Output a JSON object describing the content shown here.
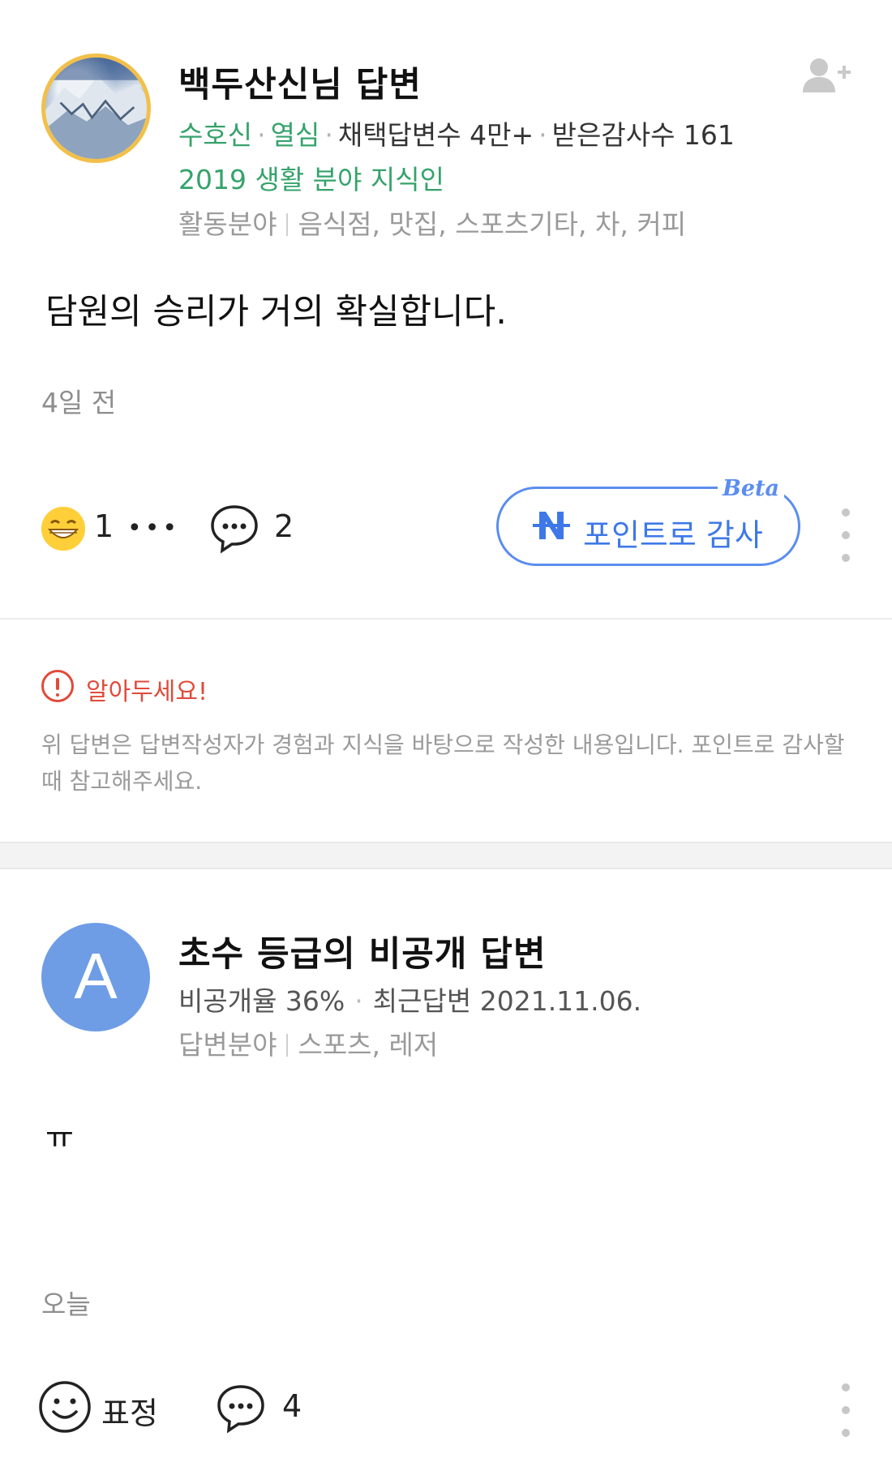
{
  "answer1": {
    "author": "백두산신님 답변",
    "grade": "수호신",
    "activity": "열심",
    "adopted": "채택답변수 4만+",
    "thanks": "받은감사수 161",
    "expert": "2019 생활 분야 지식인",
    "field_label": "활동분야",
    "fields": "음식점, 맛집, 스포츠기타, 차, 커피",
    "body": "담원의 승리가 거의 확실합니다.",
    "time": "4일 전",
    "reaction_count": "1",
    "more": "•••",
    "comment_count": "2",
    "point_button": "포인트로 감사",
    "beta": "Beta"
  },
  "notice": {
    "title": "알아두세요!",
    "text": "위 답변은 답변작성자가 경험과 지식을 바탕으로 작성한 내용입니다. 포인트로 감사할 때 참고해주세요."
  },
  "answer2": {
    "avatar_letter": "A",
    "author": "초수 등급의 비공개 답변",
    "private_rate": "비공개율 36%",
    "recent": "최근답변 2021.11.06.",
    "field_label": "답변분야",
    "fields": "스포츠, 레저",
    "body": "ㅠ",
    "time": "오늘",
    "reaction_label": "표정",
    "comment_count": "4"
  },
  "colors": {
    "green": "#35a36b",
    "blue": "#5b8def",
    "red": "#e04a3a",
    "avatar_a": "#6e9de6",
    "ring": "#f2c04a"
  }
}
